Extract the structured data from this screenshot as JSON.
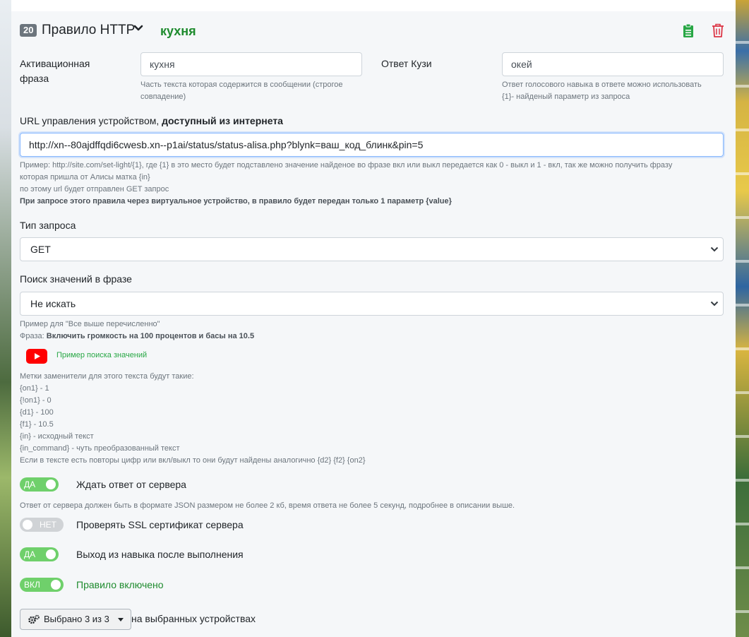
{
  "rule": {
    "number": "20",
    "title": "Правило HTTP",
    "phrase": "кухня",
    "phrase_color": "#1e8b2e"
  },
  "activation": {
    "label": "Активационная фраза",
    "label_line1": "Активационная",
    "label_line2": "фраза",
    "value": "кухня",
    "hint_line1": "Часть текста которая содержится в сообщении (строгое",
    "hint_line2": "совпадение)"
  },
  "reply": {
    "label": "Ответ Кузи",
    "value": "окей",
    "hint_line1": "Ответ голосового навыка в ответе можно использовать",
    "hint_line2": "{1}- найденый параметр из запроса"
  },
  "url": {
    "label_plain": "URL управления устройством, ",
    "label_bold": "доступный из интернета",
    "value": "http://xn--80ajdffqdi6cwesb.xn--p1ai/status/status-alisa.php?blynk=ваш_код_блинк&pin=5",
    "hint_line1": "Пример: http://site.com/set-light/{1}, где {1} в это место будет подставлено значение найденое во фразе вкл или выкл передается как 0 - выкл и 1 - вкл, так же можно получить фразу",
    "hint_line2": "которая пришла от Алисы матка {in}",
    "hint_line3": "по этому url будет отправлен GET запрос",
    "hint_bold": "При запросе этого правила через виртуальное устройство, в правило будет передан только 1 параметр {value}"
  },
  "request_type": {
    "label": "Тип запроса",
    "selected": "GET"
  },
  "value_search": {
    "label": "Поиск значений в фразе",
    "selected": "Не искать",
    "example_line1": "Пример для \"Все выше перечисленно\"",
    "example_phrase_prefix": "Фраза: ",
    "example_phrase_bold": "Включить громкость на 100 процентов и басы на 10.5",
    "video_link": "Пример поиска значений",
    "markers": [
      "Метки заменители для этого текста будут такие:",
      "{on1} - 1",
      "{!on1} - 0",
      "{d1} - 100",
      "{f1} - 10.5",
      "{in} - исходный текст",
      "{in_command} - чуть преобразованный текст",
      "Если в тексте есть повторы цифр или вкл/выкл то они будут найдены аналогично {d2} {f2} {on2}"
    ]
  },
  "toggles": {
    "wait": {
      "state": "ДА",
      "label": "Ждать ответ от сервера",
      "on": true
    },
    "wait_hint": "Ответ от сервера должен быть в формате JSON размером не более 2 кб, время ответа не более 5 секунд, подробнее в описании выше.",
    "ssl": {
      "state": "НЕТ",
      "label": "Проверять SSL сертификат сервера",
      "on": false
    },
    "exit": {
      "state": "ДА",
      "label": "Выход из навыка после выполнения",
      "on": true
    },
    "enabled": {
      "state": "ВКЛ",
      "label": "Правило включено",
      "on": true,
      "label_color": "#1e8b2e"
    }
  },
  "devices": {
    "button_label": "Выбрано 3 из 3",
    "trailing_text": "на выбранных устройствах"
  },
  "colors": {
    "accent_green": "#1e8b2e",
    "toggle_on": "#6fd06b",
    "toggle_off": "#d0d3d6",
    "delete_red": "#dc3545",
    "clipboard_green": "#28a745"
  }
}
